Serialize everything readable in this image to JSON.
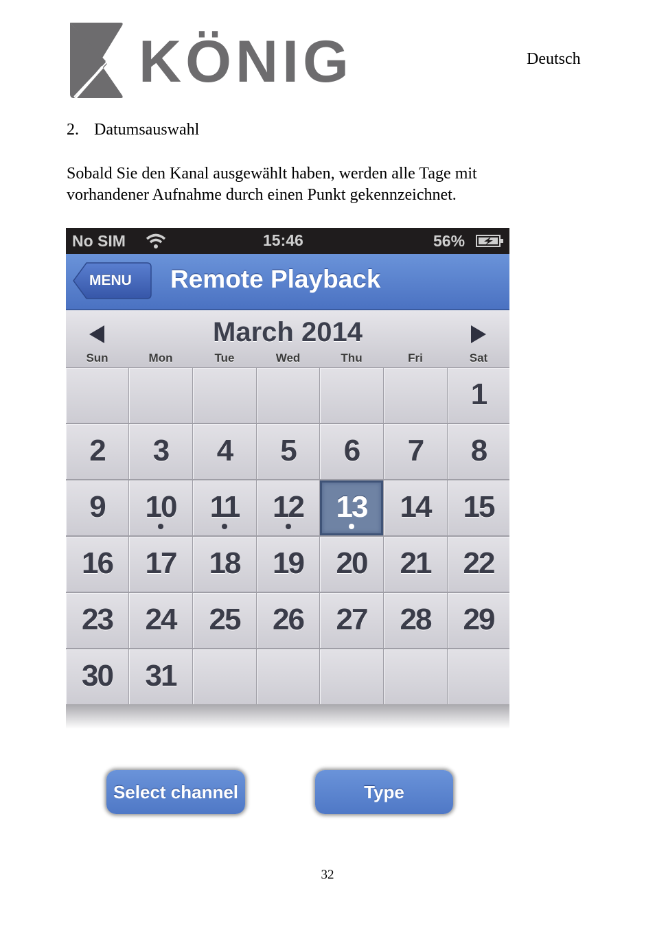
{
  "header": {
    "brand": "KÖNIG",
    "language": "Deutsch"
  },
  "section": {
    "number": "2.",
    "title": "Datumsauswahl",
    "paragraph": "Sobald Sie den Kanal ausgewählt haben, werden alle Tage mit vorhandener Aufnahme durch einen Punkt gekennzeichnet."
  },
  "phone": {
    "statusbar": {
      "carrier": "No SIM",
      "wifi_icon": "wifi-icon",
      "time": "15:46",
      "battery_percent": "56%",
      "battery_icon": "battery-charging-icon"
    },
    "navbar": {
      "menu_label": "MENU",
      "title": "Remote Playback"
    },
    "calendar": {
      "month_label": "March 2014",
      "prev_icon": "triangle-left-icon",
      "next_icon": "triangle-right-icon",
      "weekdays": [
        "Sun",
        "Mon",
        "Tue",
        "Wed",
        "Thu",
        "Fri",
        "Sat"
      ],
      "first_weekday_index": 6,
      "days_in_month": 31,
      "selected_day": 13,
      "days_with_recording": [
        10,
        11,
        12,
        13
      ],
      "accent_color": "#6f83a4"
    },
    "buttons": {
      "select_channel": "Select channel",
      "type": "Type"
    }
  },
  "footer": {
    "page_number": "32"
  }
}
